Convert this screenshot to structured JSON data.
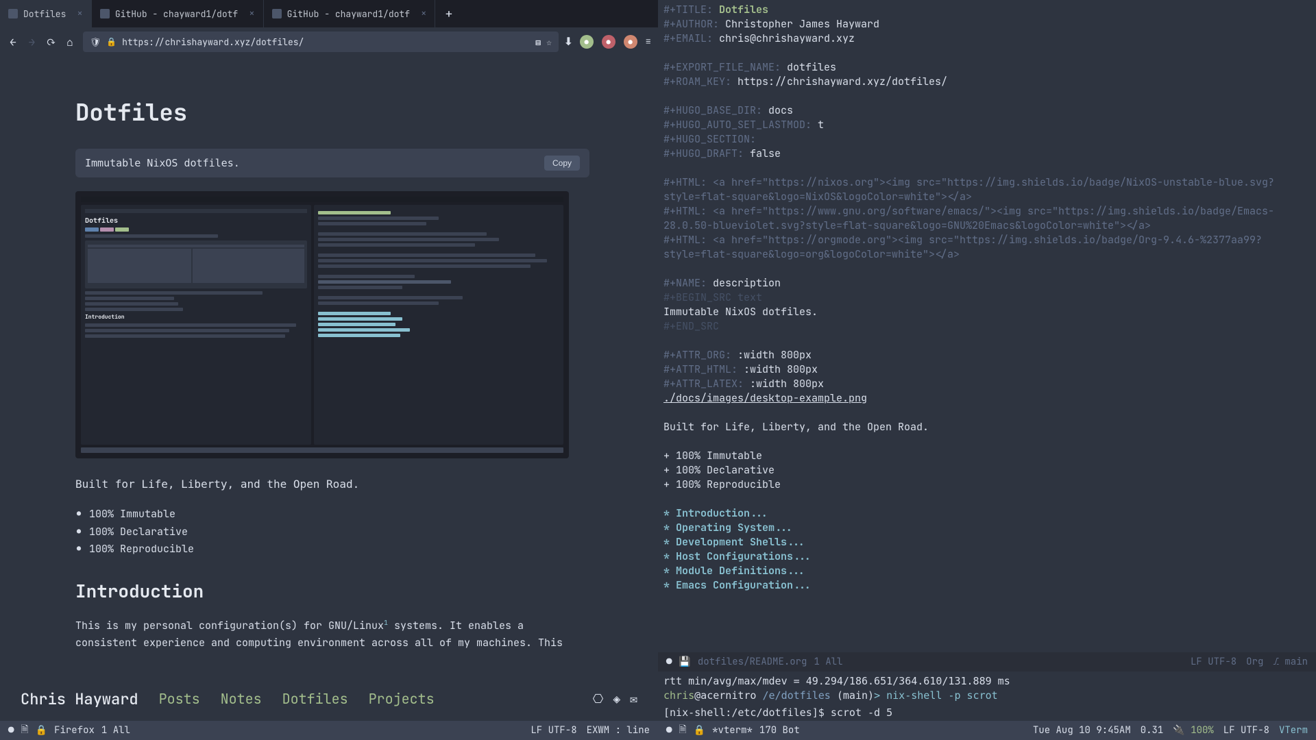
{
  "tabs": [
    {
      "label": "Dotfiles",
      "active": true
    },
    {
      "label": "GitHub - chayward1/dotf",
      "active": false
    },
    {
      "label": "GitHub - chayward1/dotf",
      "active": false
    }
  ],
  "url": "https://chrishayward.xyz/dotfiles/",
  "page": {
    "title": "Dotfiles",
    "code_desc": "Immutable NixOS dotfiles.",
    "copy_label": "Copy",
    "tagline": "Built for Life, Liberty, and the Open Road.",
    "features": [
      "100% Immutable",
      "100% Declarative",
      "100% Reproducible"
    ],
    "intro_heading": "Introduction",
    "intro_text": "This is my personal configuration(s) for GNU/Linux",
    "intro_footnote": "1",
    "intro_text2": " systems. It enables a consistent experience and computing environment across all of my machines. This"
  },
  "site_nav": {
    "brand": "Chris Hayward",
    "links": [
      "Posts",
      "Notes",
      "Dotfiles",
      "Projects"
    ]
  },
  "left_modeline": {
    "buffer": "Firefox",
    "pos": "1 All",
    "encoding": "LF UTF-8",
    "mode": "EXWM : line"
  },
  "editor": {
    "lines": [
      {
        "k": "#+TITLE: ",
        "v": "Dotfiles",
        "cls": "org-title"
      },
      {
        "k": "#+AUTHOR: ",
        "v": "Christopher James Hayward"
      },
      {
        "k": "#+EMAIL: ",
        "v": "chris@chrishayward.xyz"
      },
      {
        "blank": true
      },
      {
        "k": "#+EXPORT_FILE_NAME: ",
        "v": "dotfiles"
      },
      {
        "k": "#+ROAM_KEY: ",
        "v": "https://chrishayward.xyz/dotfiles/"
      },
      {
        "blank": true
      },
      {
        "k": "#+HUGO_BASE_DIR: ",
        "v": "docs"
      },
      {
        "k": "#+HUGO_AUTO_SET_LASTMOD: ",
        "v": "t"
      },
      {
        "k": "#+HUGO_SECTION:",
        "v": ""
      },
      {
        "k": "#+HUGO_DRAFT: ",
        "v": "false"
      },
      {
        "blank": true
      },
      {
        "raw": "#+HTML: <a href=\"https://nixos.org\"><img src=\"https://img.shields.io/badge/NixOS-unstable-blue.svg?style=flat-square&logo=NixOS&logoColor=white\"></a>",
        "cls": "org-keyword"
      },
      {
        "raw": "#+HTML: <a href=\"https://www.gnu.org/software/emacs/\"><img src=\"https://img.shields.io/badge/Emacs-28.0.50-blueviolet.svg?style=flat-square&logo=GNU%20Emacs&logoColor=white\"></a>",
        "cls": "org-keyword"
      },
      {
        "raw": "#+HTML: <a href=\"https://orgmode.org\"><img src=\"https://img.shields.io/badge/Org-9.4.6-%2377aa99?style=flat-square&logo=org&logoColor=white\"></a>",
        "cls": "org-keyword"
      },
      {
        "blank": true
      },
      {
        "k": "#+NAME: ",
        "v": "description"
      },
      {
        "raw": "#+BEGIN_SRC text",
        "cls": "org-block"
      },
      {
        "raw": "Immutable NixOS dotfiles.",
        "cls": "org-text"
      },
      {
        "raw": "#+END_SRC",
        "cls": "org-block"
      },
      {
        "blank": true
      },
      {
        "k": "#+ATTR_ORG: ",
        "v": ":width 800px"
      },
      {
        "k": "#+ATTR_HTML: ",
        "v": ":width 800px"
      },
      {
        "k": "#+ATTR_LATEX: ",
        "v": ":width 800px"
      },
      {
        "raw": "./docs/images/desktop-example.png",
        "cls": "org-link"
      },
      {
        "blank": true
      },
      {
        "raw": "Built for Life, Liberty, and the Open Road.",
        "cls": "org-text"
      },
      {
        "blank": true
      },
      {
        "raw": "+ 100% Immutable",
        "cls": "org-text"
      },
      {
        "raw": "+ 100% Declarative",
        "cls": "org-text"
      },
      {
        "raw": "+ 100% Reproducible",
        "cls": "org-text"
      },
      {
        "blank": true
      },
      {
        "raw": "* Introduction...",
        "cls": "org-heading"
      },
      {
        "raw": "* Operating System...",
        "cls": "org-heading"
      },
      {
        "raw": "* Development Shells...",
        "cls": "org-heading"
      },
      {
        "raw": "* Host Configurations...",
        "cls": "org-heading"
      },
      {
        "raw": "* Module Definitions...",
        "cls": "org-heading"
      },
      {
        "raw": "* Emacs Configuration...",
        "cls": "org-heading"
      }
    ]
  },
  "editor_modeline": {
    "file": "dotfiles/README.org",
    "pos": "1 All",
    "encoding": "LF UTF-8",
    "mode": "Org",
    "branch": "main"
  },
  "terminal": {
    "line1": "rtt min/avg/max/mdev = 49.294/186.651/364.610/131.889 ms",
    "user": "chris",
    "host": "@acernitro",
    "path": "/e/dotfiles",
    "branch": "(main)",
    "arrow": ">",
    "cmd1": "nix-shell -p scrot",
    "prompt2": "[nix-shell:/etc/dotfiles]$",
    "cmd2": "scrot -d 5"
  },
  "term_modeline": {
    "buffer": "*vterm*",
    "pos": "170 Bot",
    "datetime": "Tue Aug 10 9:45AM",
    "load": "0.31",
    "battery": "100%",
    "encoding": "LF UTF-8",
    "mode": "VTerm"
  }
}
